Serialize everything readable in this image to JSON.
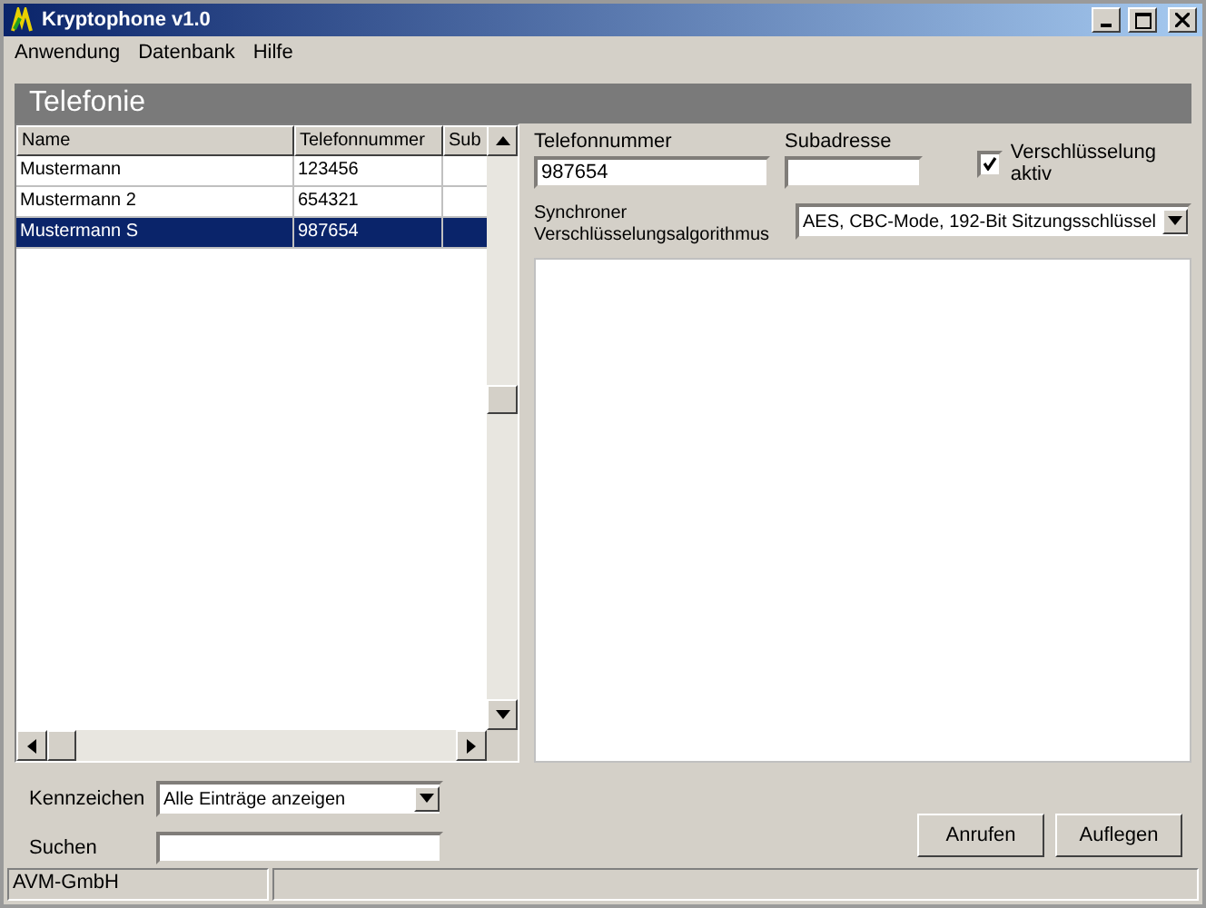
{
  "window": {
    "title": "Kryptophone v1.0"
  },
  "menu": [
    "Anwendung",
    "Datenbank",
    "Hilfe"
  ],
  "section_title": "Telefonie",
  "table": {
    "columns": [
      "Name",
      "Telefonnummer",
      "Sub"
    ],
    "rows": [
      {
        "cells": [
          "Mustermann",
          "123456",
          ""
        ],
        "selected": false
      },
      {
        "cells": [
          "Mustermann 2",
          "654321",
          ""
        ],
        "selected": false
      },
      {
        "cells": [
          "Mustermann S",
          "987654",
          ""
        ],
        "selected": true
      }
    ]
  },
  "phone": {
    "label": "Telefonnummer",
    "value": "987654"
  },
  "subaddress": {
    "label": "Subadresse"
  },
  "encryption": {
    "label": "Verschlüsselung aktiv",
    "checked": true
  },
  "algorithm": {
    "label": "Synchroner Verschlüsselungsalgorithmus",
    "value": "AES, CBC-Mode, 192-Bit Sitzungsschlüssel"
  },
  "filter": {
    "label": "Kennzeichen",
    "value": "Alle Einträge anzeigen"
  },
  "search": {
    "label": "Suchen"
  },
  "buttons": [
    "Anrufen",
    "Auflegen"
  ],
  "status_bar": [
    "AVM-GmbH"
  ]
}
